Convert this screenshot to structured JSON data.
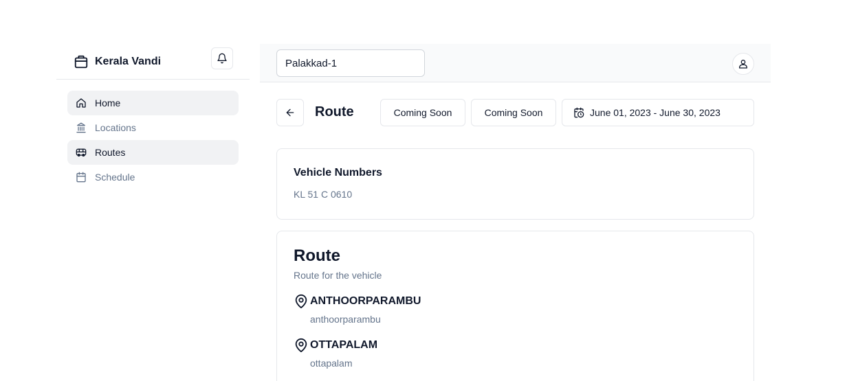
{
  "brand": {
    "name": "Kerala Vandi",
    "icon": "store-icon"
  },
  "sidebar": {
    "items": [
      {
        "label": "Home",
        "icon": "home-icon",
        "active": true
      },
      {
        "label": "Locations",
        "icon": "landmark-icon",
        "active": false
      },
      {
        "label": "Routes",
        "icon": "bus-icon",
        "active": true
      },
      {
        "label": "Schedule",
        "icon": "calendar-icon",
        "active": false
      }
    ]
  },
  "topbar": {
    "store": "Palakkad-1"
  },
  "header": {
    "title": "Route",
    "button1": "Coming Soon",
    "button2": "Coming Soon",
    "date_range": "June 01, 2023 - June 30, 2023"
  },
  "vehicles": {
    "heading": "Vehicle Numbers",
    "value": "KL 51 C 0610"
  },
  "route": {
    "title": "Route",
    "subtitle": "Route for the vehicle",
    "stops": [
      {
        "name": "ANTHOORPARAMBU",
        "sub": "anthoorparambu"
      },
      {
        "name": "OTTAPALAM",
        "sub": "ottapalam"
      }
    ]
  },
  "colors": {
    "text": "#0f172a",
    "muted": "#64748b",
    "border": "#e5e7eb",
    "active_bg": "#f1f2f4"
  }
}
